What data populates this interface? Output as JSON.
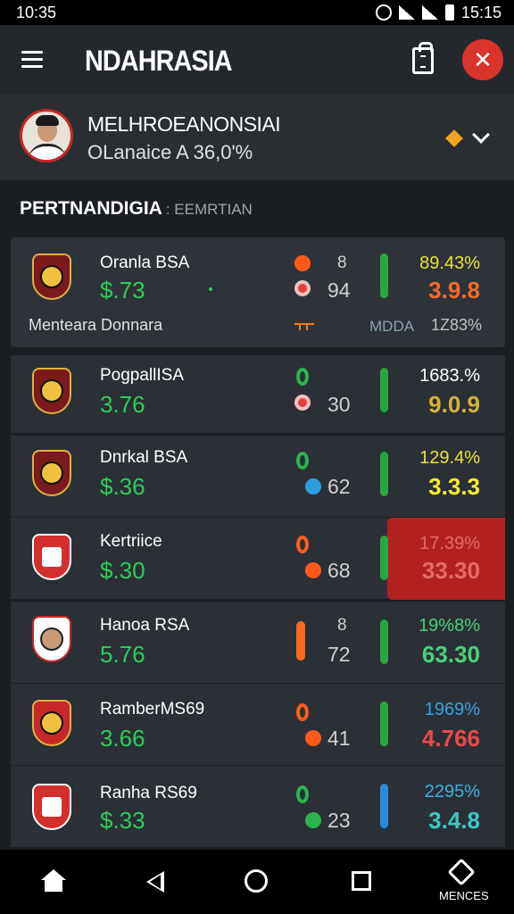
{
  "status_bar": {
    "time_left": "10:35",
    "time_right": "15:15"
  },
  "app_bar": {
    "title": "NDAHRASIA"
  },
  "profile": {
    "name": "MELHROEANONSIAI",
    "subtitle": "OLanaice A 36,0'%"
  },
  "section": {
    "title": "PERTNANDIGIA",
    "subtitle": ": EEMRTIAN"
  },
  "matches": [
    {
      "team": "Oranla BSA",
      "price": "$.73",
      "top_count": "8",
      "count": "94",
      "pct": "89.43%",
      "big": "3.9.8",
      "extra_left": "Menteara Donnara",
      "extra_mid": "MDDA",
      "extra_right": "1Z83%",
      "pct_color": "#e8e23a",
      "big_color": "#f26a2a"
    },
    {
      "team": "PogpallISA",
      "price": "3.76",
      "count": "30",
      "pct": "1683.%",
      "big": "9.0.9",
      "pct_color": "#ffffff",
      "big_color": "#d4b23a"
    },
    {
      "team": "Dnrkal BSA",
      "price": "$.36",
      "count": "62",
      "pct": "129.4%",
      "big": "3.3.3",
      "pct_color": "#e8e23a",
      "big_color": "#f5ec3a"
    },
    {
      "team": "Kertriice",
      "price": "$.30",
      "count": "68",
      "pct": "17.39%",
      "big": "33.30",
      "pct_color": "#e36a6a",
      "big_color": "#e36a6a"
    },
    {
      "team": "Hanoa RSA",
      "price": "5.76",
      "top_count": "8",
      "count": "72",
      "pct": "19%8%",
      "big": "63.30",
      "pct_color": "#4ad07a",
      "big_color": "#4ad07a"
    },
    {
      "team": "RamberMS69",
      "price": "3.66",
      "count": "41",
      "pct": "1969%",
      "big": "4.766",
      "pct_color": "#3aa0e0",
      "big_color": "#e84a4a"
    },
    {
      "team": "Ranha RS69",
      "price": "$.33",
      "count": "23",
      "pct": "2295%",
      "big": "3.4.8",
      "pct_color": "#3ab0e0",
      "big_color": "#3ac8c0"
    }
  ],
  "nav_bar": {
    "more_label": "MENCES"
  }
}
